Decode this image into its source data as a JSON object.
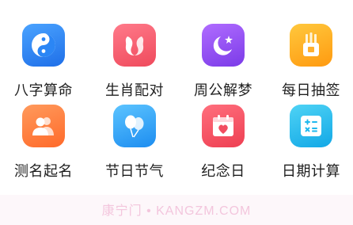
{
  "tools": [
    {
      "label": "八字算命",
      "icon": "yin-yang-icon",
      "color": "#2b86f5"
    },
    {
      "label": "生肖配对",
      "icon": "zodiac-pair-icon",
      "color": "#f2586a"
    },
    {
      "label": "周公解梦",
      "icon": "moon-star-icon",
      "color": "#9150f0"
    },
    {
      "label": "每日抽签",
      "icon": "fortune-sticks-icon",
      "color": "#ffae22"
    },
    {
      "label": "测名起名",
      "icon": "people-icon",
      "color": "#ff7b3c"
    },
    {
      "label": "节日节气",
      "icon": "balloons-icon",
      "color": "#2ba0f5"
    },
    {
      "label": "纪念日",
      "icon": "calendar-heart-icon",
      "color": "#f24d60"
    },
    {
      "label": "日期计算",
      "icon": "calculator-icon",
      "color": "#1fb8ee"
    }
  ],
  "watermark": "康宁门 • KANGZM.COM"
}
